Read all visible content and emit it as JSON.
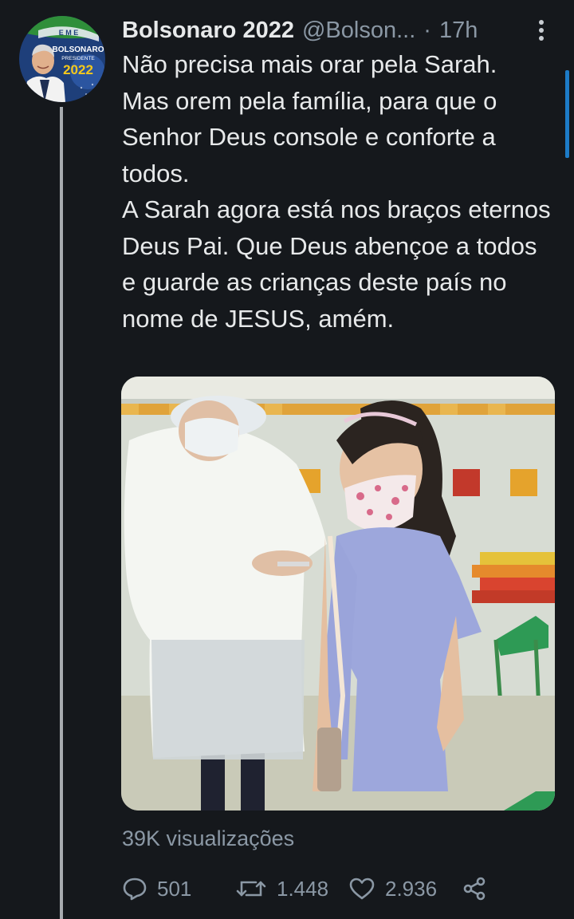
{
  "tweet": {
    "display_name": "Bolsonaro 2022",
    "handle": "@Bolson...",
    "separator": "·",
    "time": "17h",
    "text": "Não precisa mais orar pela Sarah.\nMas orem pela família, para que o Senhor Deus console e conforte a todos.\nA Sarah agora está nos braços eternos Deus Pai. Que Deus abençoe a todos e guarde as crianças deste país no nome de JESUS, amém.",
    "views": "39K visualizações",
    "replies": "501",
    "retweets": "1.448",
    "likes": "2.936"
  },
  "avatar": {
    "badge_top": "BOLSONARO",
    "badge_mid": "PRESIDENTE",
    "badge_year": "2022",
    "banner_text": "E M E"
  },
  "colors": {
    "background": "#15181c",
    "text": "#e7e9ea",
    "muted": "#8b98a5",
    "thread_line": "#a7abaf",
    "accent": "#1d7bc7"
  },
  "icons": {
    "more": "more-vertical-icon",
    "reply": "reply-icon",
    "retweet": "retweet-icon",
    "like": "heart-icon",
    "share": "share-icon"
  }
}
